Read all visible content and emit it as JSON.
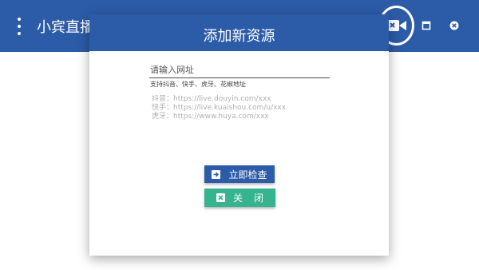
{
  "app": {
    "title": "小宾直播",
    "menu_icon": "more-vert-icon",
    "record_icon": "video-camera-icon",
    "maximize_icon": "maximize-icon",
    "close_icon": "close-circle-icon"
  },
  "dialog": {
    "title": "添加新资源",
    "url_input": {
      "value": "",
      "placeholder": "请输入网址"
    },
    "hint": "支持抖音、快手、虎牙、花椒地址",
    "examples": [
      "抖音：https://live.douyin.com/xxx",
      "快手：https://live.kuaishou.com/u/xxx",
      "虎牙：https://www.huya.com/xxx"
    ],
    "check_button": {
      "label": "立即检查",
      "icon": "arrow-right-box-icon"
    },
    "close_button": {
      "label": "关闭",
      "icon": "close-box-icon"
    }
  },
  "colors": {
    "primary": "#2c5ba7",
    "accent_green": "#36b38f",
    "example_text": "#b0b0b0"
  }
}
